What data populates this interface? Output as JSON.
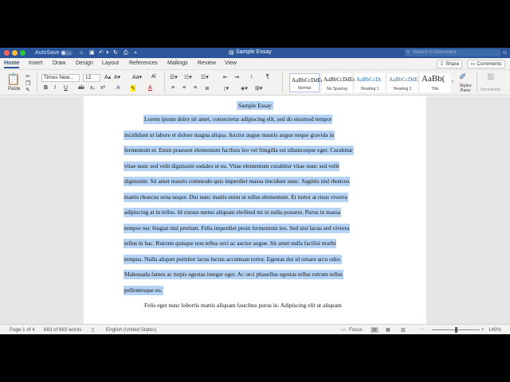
{
  "titlebar": {
    "autosave_label": "AutoSave",
    "autosave_state": "OFF",
    "doc_title": "Sample Essay",
    "search_placeholder": "Search in Document"
  },
  "tabs": [
    {
      "label": "Home",
      "active": true
    },
    {
      "label": "Insert"
    },
    {
      "label": "Draw"
    },
    {
      "label": "Design"
    },
    {
      "label": "Layout"
    },
    {
      "label": "References"
    },
    {
      "label": "Mailings"
    },
    {
      "label": "Review"
    },
    {
      "label": "View"
    }
  ],
  "tab_actions": {
    "share": "Share",
    "comments": "Comments"
  },
  "ribbon": {
    "paste_label": "Paste",
    "font_name": "Times New...",
    "font_size": "12",
    "styles": [
      {
        "sample": "AaBbCcDdEe",
        "name": "Normal"
      },
      {
        "sample": "AaBbCcDdEe",
        "name": "No Spacing"
      },
      {
        "sample": "AaBbCcDc",
        "name": "Heading 1"
      },
      {
        "sample": "AaBbCcDdE",
        "name": "Heading 2"
      },
      {
        "sample": "AaBb(",
        "name": "Title"
      }
    ],
    "styles_pane_label": "Styles Pane",
    "sensitivity_label": "Sensitivity"
  },
  "document": {
    "title": "Sample Essay",
    "lines": [
      "Lorem ipsum dolor sit amet, consectetur adipiscing elit, sed do eiusmod tempor",
      "incididunt ut labore et dolore magna aliqua. Auctor augue mauris augue neque gravida in",
      "fermentum et. Enim praesent elementum facilisis leo vel fringilla est ullamcorper eget. Curabitur",
      "vitae nunc sed velit dignissim sodales ut eu. Vitae elementum curabitur vitae nunc sed velit",
      "dignissim. Sit amet mauris commodo quis imperdiet massa tincidunt nunc. Sagittis nisl rhoncus",
      "mattis rhoncus urna neque. Dui nunc mattis enim ut tellus elementum. Et tortor at risus viverra",
      "adipiscing at in tellus. Id cursus metus aliquam eleifend mi in nulla posuere. Purus in massa",
      "tempor nec feugiat nisl pretium. Felis imperdiet proin fermentum leo. Sed nisi lacus sed viverra",
      "tellus in hac. Rutrum quisque non tellus orci ac auctor augue. Sit amet nulla facilisi morbi",
      "tempus. Nulla aliquet porttitor lacus luctus accumsan tortor. Egestas dui id ornare arcu odio.",
      "Malesuada fames ac turpis egestas integer eget. Ac orci phasellus egestas tellus rutrum tellus",
      "pellentesque eu.",
      "Felis eget nunc lobortis mattis aliquam faucibus purus in. Adipiscing elit ut aliquam"
    ]
  },
  "statusbar": {
    "page": "Page 1 of 4",
    "words": "683 of 683 words",
    "language": "English (United States)",
    "focus": "Focus",
    "zoom": "140%"
  },
  "colors": {
    "titlebar": "#2b579a",
    "selection": "#b4d3f5"
  }
}
